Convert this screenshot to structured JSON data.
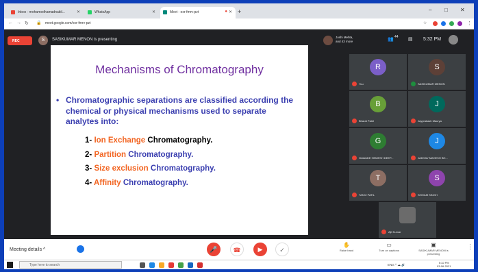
{
  "browser": {
    "tabs": [
      {
        "title": "Inbox - mohamedhamadnabil...",
        "color": "#ea4335"
      },
      {
        "title": "WhatsApp",
        "color": "#25d366"
      },
      {
        "title": "Meet - oxr-fmrv-pzt",
        "color": "#00897b"
      }
    ],
    "url": "meet.google.com/oxr-fmrv-pzt",
    "win_controls": [
      "–",
      "□",
      "✕"
    ],
    "ext_colors": [
      "#ea4335",
      "#1a73e8",
      "#34a853",
      "#8e24aa"
    ]
  },
  "meet": {
    "rec_label": "REC",
    "presenter_initial": "S",
    "presenting_text": "SASIKUMAR MENON is presenting",
    "participants_label": "Joshi Mehta, and 43 more",
    "participant_count": "44",
    "clock": "5:32 PM"
  },
  "slide": {
    "title": "Mechanisms of Chromatography",
    "bullet": "Chromatographic separations are classified according the chemical or physical mechanisms used to separate analytes into:",
    "items": [
      {
        "num": "1-",
        "highlight": "Ion Exchange",
        "rest": "Chromatography.",
        "rest_color": "black"
      },
      {
        "num": "2-",
        "highlight": "Partition",
        "rest": "Chromatography.",
        "rest_color": "blue"
      },
      {
        "num": "3-",
        "highlight": "Size exclusion",
        "rest": "Chromatography.",
        "rest_color": "blue"
      },
      {
        "num": "4-",
        "highlight": "Affinity",
        "rest": "Chromatography.",
        "rest_color": "blue"
      }
    ]
  },
  "participants": [
    {
      "initial": "R",
      "name": "You",
      "color": "#7b5fc8"
    },
    {
      "initial": "S",
      "name": "SASIKUMAR MENON",
      "color": "#5d4037"
    },
    {
      "initial": "B",
      "name": "Bharat Patel",
      "color": "#689f38"
    },
    {
      "initial": "J",
      "name": "Jayprakash Maurya",
      "color": "#00695c"
    },
    {
      "initial": "G",
      "name": "GAWADE HEMESH DEEP...",
      "color": "#2e7d32"
    },
    {
      "initial": "J",
      "name": "JADHAV MAHESH BH...",
      "color": "#1e88e5"
    },
    {
      "initial": "T",
      "name": "TANVI PATIL",
      "color": "#8d6e63"
    },
    {
      "initial": "S",
      "name": "SHIVAM SINGH",
      "color": "#8e44ad"
    },
    {
      "initial": "",
      "name": "Ajit Kumar",
      "color": "#555555"
    }
  ],
  "controls": {
    "meeting_details": "Meeting details",
    "raise_hand": "Raise hand",
    "captions": "Turn on captions",
    "presenting": "SASIKUMAR MENON is presenting",
    "more": "⋮"
  },
  "taskbar": {
    "search_placeholder": "Type here to search",
    "tray": "ENG  ^ ☁ 🔊",
    "time": "5:32 PM",
    "date": "03-06-2021"
  }
}
